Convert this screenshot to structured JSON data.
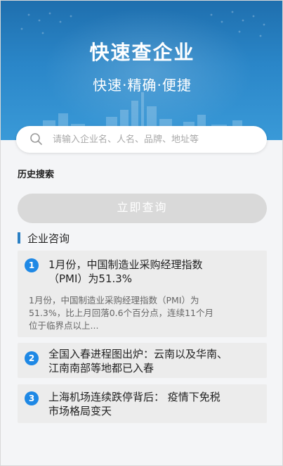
{
  "hero": {
    "title": "快速查企业",
    "subtitle": "快速·精确·便捷"
  },
  "search": {
    "placeholder": "请输入企业名、人名、品牌、地址等",
    "icon": "search-icon"
  },
  "history": {
    "label": "历史搜索"
  },
  "query_button": {
    "label": "立即查询"
  },
  "news_section": {
    "title": "企业咨询",
    "items": [
      {
        "index": "1",
        "title_line1": "1月份，中国制造业采购经理指数",
        "title_line2": "（PMI）为51.3%",
        "summary_line1": "1月份，中国制造业采购经理指数（PMI）为",
        "summary_line2": "51.3%，比上月回落0.6个百分点，连续11个月",
        "summary_line3": "位于临界点以上..."
      },
      {
        "index": "2",
        "title_line1": "全国入春进程图出炉：云南以及华南、",
        "title_line2": "江南南部等地都已入春"
      },
      {
        "index": "3",
        "title_line1": "上海机场连续跌停背后：  疫情下免税",
        "title_line2": "市场格局变天"
      }
    ]
  },
  "colors": {
    "hero_top": "#1f6fae",
    "hero_bottom": "#3a9ad8",
    "accent": "#2b80c4",
    "badge": "#1e88e5",
    "button_disabled": "#d9d9d9"
  }
}
